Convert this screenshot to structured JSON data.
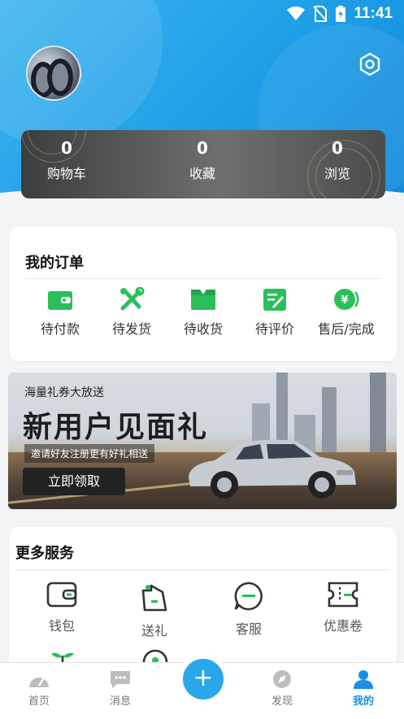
{
  "status_bar": {
    "time": "11:41",
    "icons": [
      "wifi-icon",
      "no-sim-icon",
      "battery-charging-icon"
    ]
  },
  "profile": {
    "avatar_icon": "avatar",
    "settings_icon": "settings-icon"
  },
  "stats": [
    {
      "value": "0",
      "label": "购物车"
    },
    {
      "value": "0",
      "label": "收藏"
    },
    {
      "value": "0",
      "label": "浏览"
    }
  ],
  "orders": {
    "title": "我的订单",
    "items": [
      {
        "label": "待付款",
        "icon": "wallet-icon"
      },
      {
        "label": "待发货",
        "icon": "tools-icon"
      },
      {
        "label": "待收货",
        "icon": "package-icon"
      },
      {
        "label": "待评价",
        "icon": "review-icon"
      },
      {
        "label": "售后/完成",
        "icon": "refund-icon"
      }
    ],
    "accent": "#2bbf5a"
  },
  "banner": {
    "small_text": "海量礼券大放送",
    "headline": "新用户见面礼",
    "sub_text": "邀请好友注册更有好礼相送",
    "button": "立即领取"
  },
  "services": {
    "title": "更多服务",
    "items": [
      {
        "label": "钱包",
        "icon": "wallet-outline-icon"
      },
      {
        "label": "送礼",
        "icon": "gift-tag-icon"
      },
      {
        "label": "客服",
        "icon": "chat-icon"
      },
      {
        "label": "优惠卷",
        "icon": "coupon-icon"
      }
    ]
  },
  "tabbar": {
    "items": [
      {
        "label": "首页",
        "icon": "speedometer-icon"
      },
      {
        "label": "消息",
        "icon": "message-icon"
      },
      {
        "label": "发现",
        "icon": "compass-icon"
      },
      {
        "label": "我的",
        "icon": "user-icon",
        "active": true
      }
    ],
    "fab": "+",
    "active_color": "#1b8fe0"
  }
}
